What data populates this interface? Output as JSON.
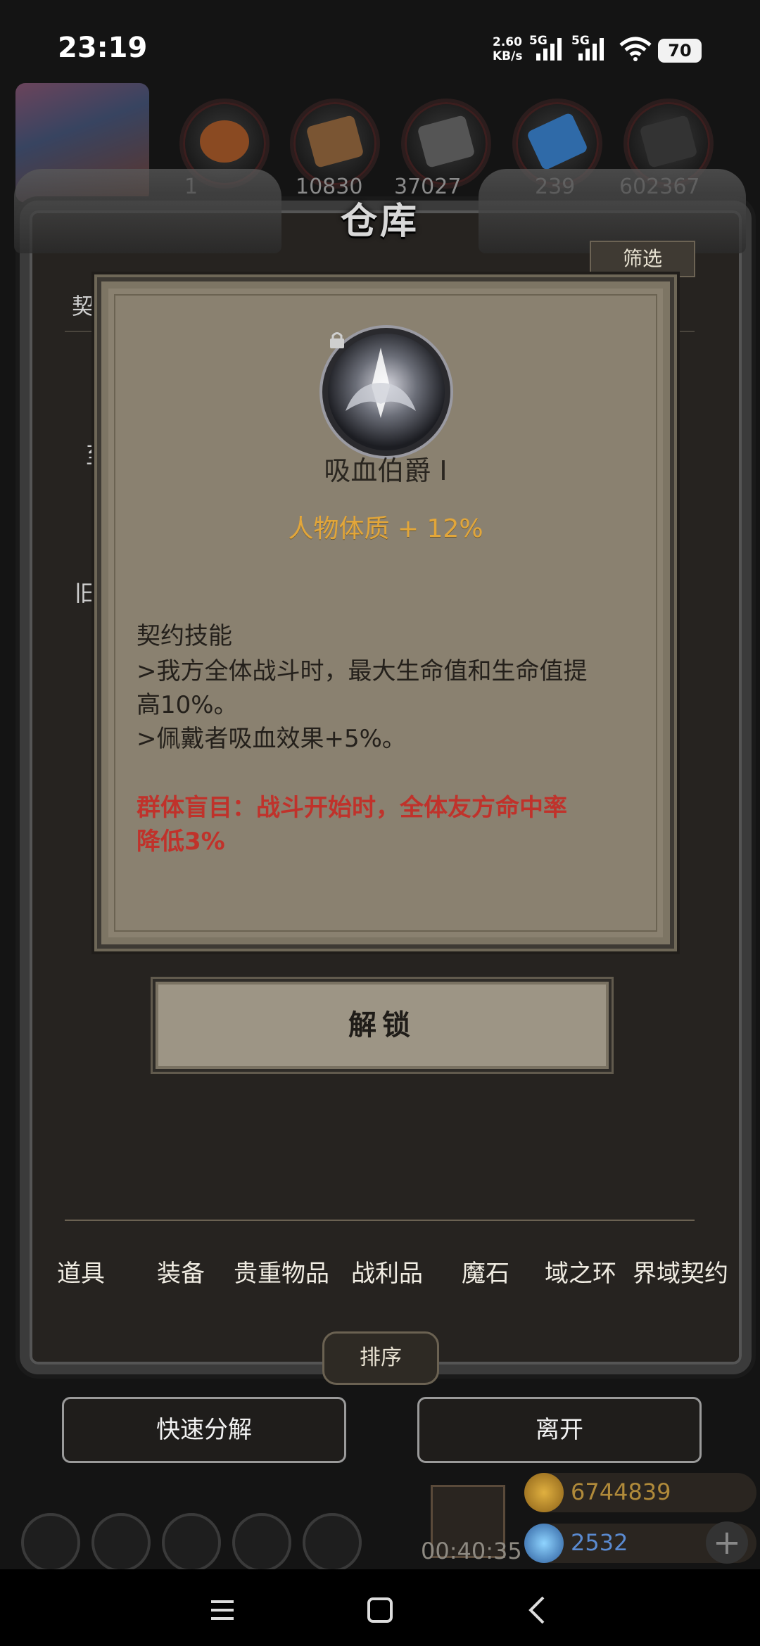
{
  "status_bar": {
    "time": "23:19",
    "net_speed": "2.60",
    "net_unit": "KB/s",
    "net_type1": "5G",
    "net_type2": "5G",
    "battery": "70"
  },
  "header": {
    "resource_values": [
      "1",
      "10830",
      "37027",
      "",
      "239",
      "602367"
    ]
  },
  "warehouse": {
    "title": "仓库",
    "filter_label": "筛选",
    "side_labels": [
      "契",
      "至",
      "旧"
    ]
  },
  "item_modal": {
    "name": "吸血伯爵 I",
    "attribute": "人物体质 + 12%",
    "skill_title": "契约技能",
    "skill_lines": [
      ">我方全体战斗时，最大生命值和生命值提",
      "高10%。",
      ">佩戴者吸血效果+5%。"
    ],
    "debuff_lines": [
      "群体盲目：战斗开始时，全体友方命中率",
      "降低3%"
    ]
  },
  "unlock_label": "解锁",
  "tabs": [
    "道具",
    "装备",
    "贵重物品",
    "战利品",
    "魔石",
    "域之环",
    "界域契约"
  ],
  "sort_label": "排序",
  "quick_decompose_label": "快速分解",
  "leave_label": "离开",
  "bottom": {
    "timer": "00:40:35",
    "gold": "6744839",
    "gems": "2532"
  },
  "colors": {
    "modal_bg": "#8a8170",
    "attribute_gold": "#e2a63a",
    "debuff_red": "#c0322b"
  }
}
